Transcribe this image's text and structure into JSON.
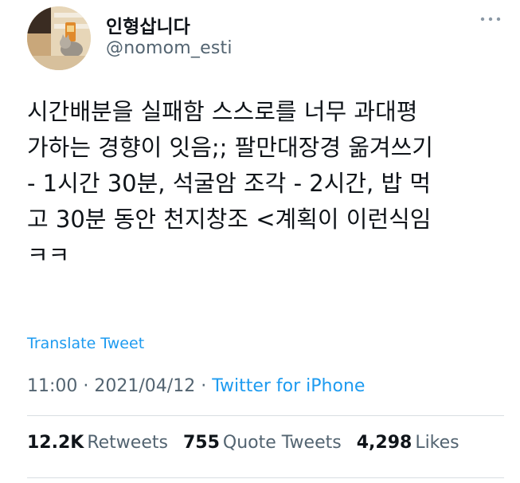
{
  "user": {
    "display_name": "인형삽니다",
    "handle": "@nomom_esti"
  },
  "tweet": {
    "text": "시간배분을 실패함 스스로를 너무 과대평\n가하는 경향이 잇음;; 팔만대장경 옮겨쓰기\n- 1시간 30분, 석굴암 조각 - 2시간, 밥 먹\n고 30분 동안 천지창조 <계획이 이런식임\nㅋㅋ",
    "translate_label": "Translate Tweet",
    "time": "11:00",
    "separator": " · ",
    "date": "2021/04/12",
    "source": "Twitter for iPhone"
  },
  "stats": {
    "retweets_count": "12.2K",
    "retweets_label": "Retweets",
    "quotes_count": "755",
    "quotes_label": "Quote Tweets",
    "likes_count": "4,298",
    "likes_label": "Likes"
  },
  "icons": {
    "more": "more-horizontal-icon"
  },
  "colors": {
    "link": "#1d9bf0",
    "secondary_text": "#536471",
    "primary_text": "#0f1419"
  }
}
